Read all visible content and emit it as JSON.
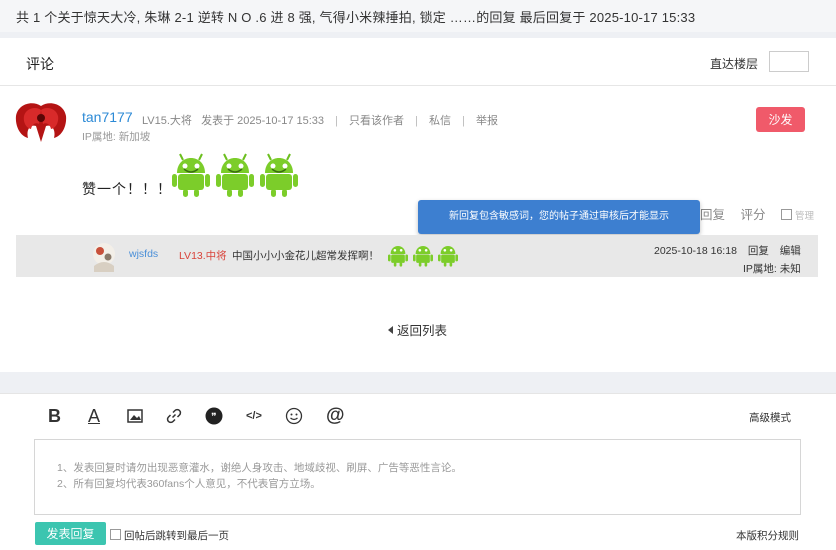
{
  "topbar": {
    "text": "共 1 个关于惊天大冷, 朱琳 2-1 逆转 N O .6 进 8 强, 气得小米辣捶拍, 锁定 ……的回复 最后回复于 2025-10-17 15:33"
  },
  "comments": {
    "title": "评论",
    "jump_label": "直达楼层",
    "jump_value": ""
  },
  "post": {
    "username": "tan7177",
    "level": "LV15.大将",
    "posted": "发表于 2025-10-17 15:33",
    "view_author": "只看该作者",
    "private_msg": "私信",
    "report": "举报",
    "ip": "IP属地: 新加坡",
    "sofa": "沙发",
    "content": "赞一个！！！",
    "actions": {
      "reply": "回复",
      "rate": "评分",
      "manage": "管理"
    },
    "emoji_icon": "android-emoji-icon"
  },
  "toast": {
    "text": "新回复包含敏感词，您的帖子通过审核后才能显示"
  },
  "reply": {
    "username": "wjsfds",
    "level": "LV13.中将",
    "text": "中国小小小金花儿超常发挥啊！",
    "time": "2025-10-18 16:18",
    "reply": "回复",
    "edit": "编辑",
    "ip": "IP属地: 未知"
  },
  "back_to_list": "返回列表",
  "editor": {
    "tools": [
      "bold-icon",
      "text-color-icon",
      "image-icon",
      "link-icon",
      "quote-icon",
      "code-icon",
      "emoji-icon",
      "mention-icon"
    ],
    "advanced": "高级模式",
    "placeholder_line1": "1、发表回复时请勿出现恶意灌水，谢绝人身攻击、地域歧视、刷屏、广告等恶性言论。",
    "placeholder_line2": "2、所有回复均代表360fans个人意见，不代表官方立场。",
    "submit": "发表回复",
    "after_post": "回帖后跳转到最后一页",
    "rules": "本版积分规则"
  },
  "colors": {
    "link_blue": "#2c8ad6",
    "sofa_red": "#f05a6a",
    "toast_blue": "#3d7fd0",
    "submit_teal": "#3cc5b0"
  }
}
